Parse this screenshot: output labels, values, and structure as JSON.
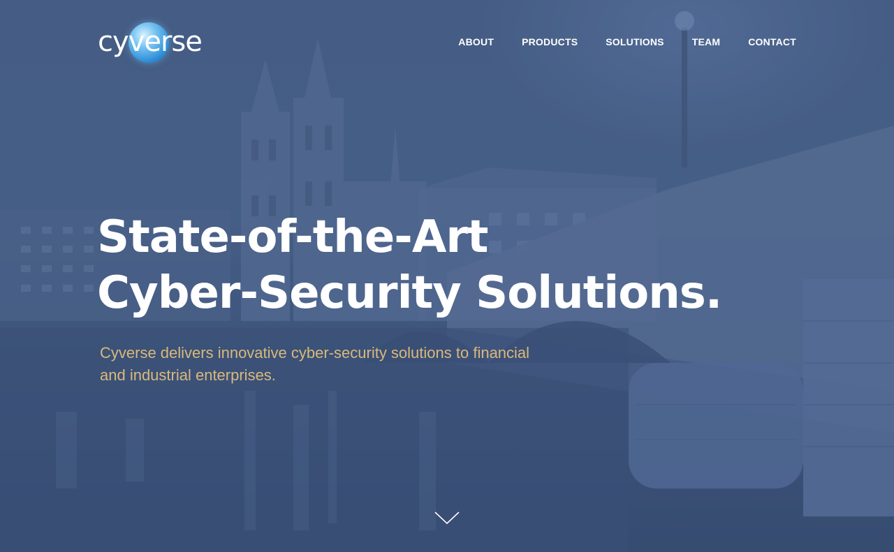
{
  "brand": {
    "logo_text": "cyverse",
    "accent_color": "#3a9be3"
  },
  "nav": {
    "items": [
      {
        "label": "ABOUT"
      },
      {
        "label": "PRODUCTS"
      },
      {
        "label": "SOLUTIONS"
      },
      {
        "label": "TEAM"
      },
      {
        "label": "CONTACT"
      }
    ]
  },
  "hero": {
    "headline_line1": "State-of-the-Art",
    "headline_line2": "Cyber-Security Solutions.",
    "tagline": "Cyverse delivers innovative cyber-security solutions to financial and industrial enterprises.",
    "tagline_color": "#d9b97a",
    "background_tint": "#3b4f6e",
    "scroll_icon": "chevron-down-icon"
  }
}
